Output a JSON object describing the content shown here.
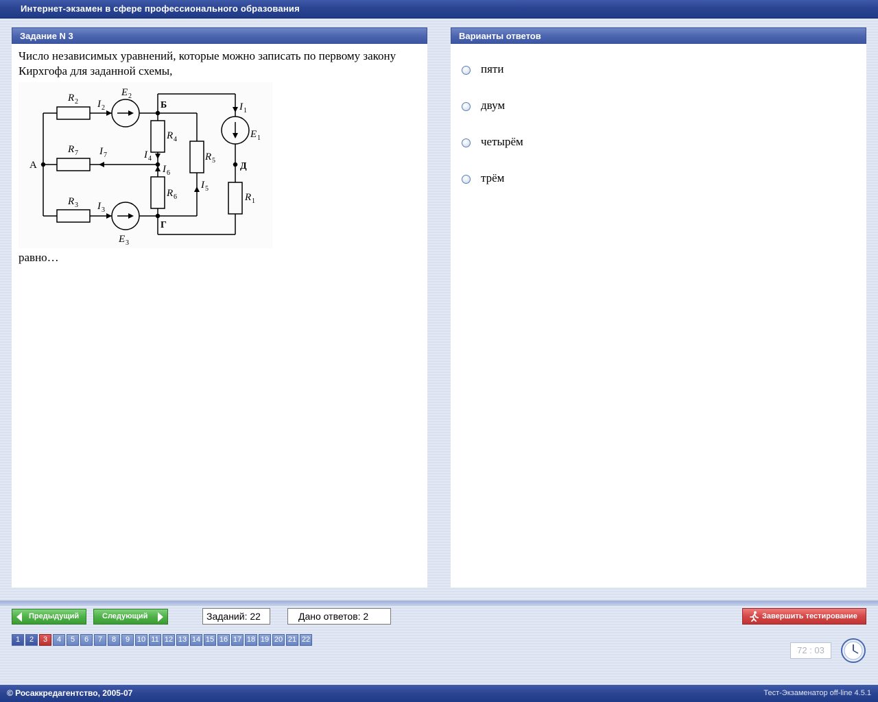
{
  "window": {
    "title": "Интернет-экзамен в сфере профессионального образования"
  },
  "task_panel": {
    "header": "Задание N 3",
    "question": "Число независимых уравнений, которые можно записать по первому закону Кирхгофа для заданной схемы,",
    "question_tail": "равно…",
    "circuit": {
      "nodes": [
        "А",
        "Б",
        "Г",
        "Д"
      ],
      "resistors": [
        "R2",
        "R7",
        "R3",
        "R4",
        "R6",
        "R5",
        "R1"
      ],
      "sources": [
        "E2",
        "E3",
        "E1"
      ],
      "currents": [
        "I2",
        "I7",
        "I3",
        "I4",
        "I6",
        "I5",
        "I1"
      ]
    }
  },
  "answers_panel": {
    "header": "Варианты ответов",
    "options": [
      {
        "label": "пяти",
        "selected": false
      },
      {
        "label": "двум",
        "selected": false
      },
      {
        "label": "четырём",
        "selected": false
      },
      {
        "label": "трём",
        "selected": false
      }
    ]
  },
  "navigation": {
    "prev_label": "Предыдущий",
    "next_label": "Следующий",
    "tasks_count_text": "Заданий: 22",
    "answered_text": "Дано ответов: 2",
    "finish_label": "Завершить тестирование",
    "current_page": 3,
    "visited_pages": [
      1,
      2
    ],
    "pages": [
      "1",
      "2",
      "3",
      "4",
      "5",
      "6",
      "7",
      "8",
      "9",
      "10",
      "11",
      "12",
      "13",
      "14",
      "15",
      "16",
      "17",
      "18",
      "19",
      "20",
      "21",
      "22"
    ]
  },
  "timer": {
    "value": "72 : 03",
    "icon": "clock-icon"
  },
  "footer": {
    "copyright": "© Росаккредагентство, 2005-07",
    "version": "Тест-Экзаменатор off-line 4.5.1"
  },
  "colors": {
    "title_bar": "#2b4593",
    "panel_header": "#4d66b0",
    "nav_button": "#4fb248",
    "finish_button": "#d44848",
    "current_page": "#b83232"
  }
}
